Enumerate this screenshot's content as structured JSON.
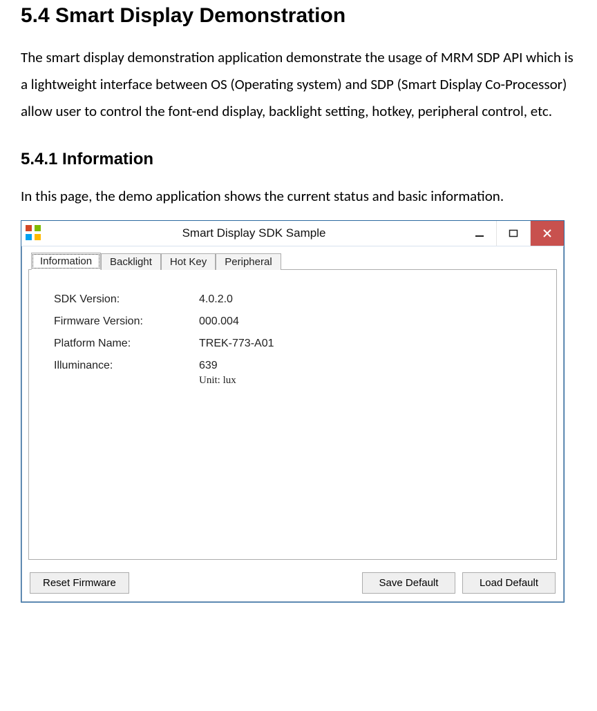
{
  "doc": {
    "heading": "5.4 Smart Display Demonstration",
    "intro": "The smart display demonstration application demonstrate the usage of MRM SDP API which is a lightweight interface between OS (Operating system) and SDP (Smart Display Co-Processor) allow user to control the font-end display, backlight setting, hotkey, peripheral control, etc.",
    "subheading": "5.4.1 Information",
    "subintro": "In this page, the demo application shows the current status and basic information."
  },
  "window": {
    "title": "Smart Display SDK Sample",
    "tabs": [
      "Information",
      "Backlight",
      "Hot Key",
      "Peripheral"
    ],
    "active_tab_index": 0,
    "info": {
      "rows": [
        {
          "label": "SDK Version:",
          "value": "4.0.2.0"
        },
        {
          "label": "Firmware Version:",
          "value": "000.004"
        },
        {
          "label": "Platform Name:",
          "value": "TREK-773-A01"
        },
        {
          "label": "Illuminance:",
          "value": "639"
        }
      ],
      "unit": "Unit: lux"
    },
    "buttons": {
      "reset": "Reset Firmware",
      "save": "Save Default",
      "load": "Load Default"
    },
    "titlebar_icons": {
      "minimize": "minimize-icon",
      "maximize": "maximize-icon",
      "close": "close-icon",
      "app": "app-icon"
    },
    "colors": {
      "close_bg": "#c8514e",
      "border": "#2c6aa0"
    }
  }
}
